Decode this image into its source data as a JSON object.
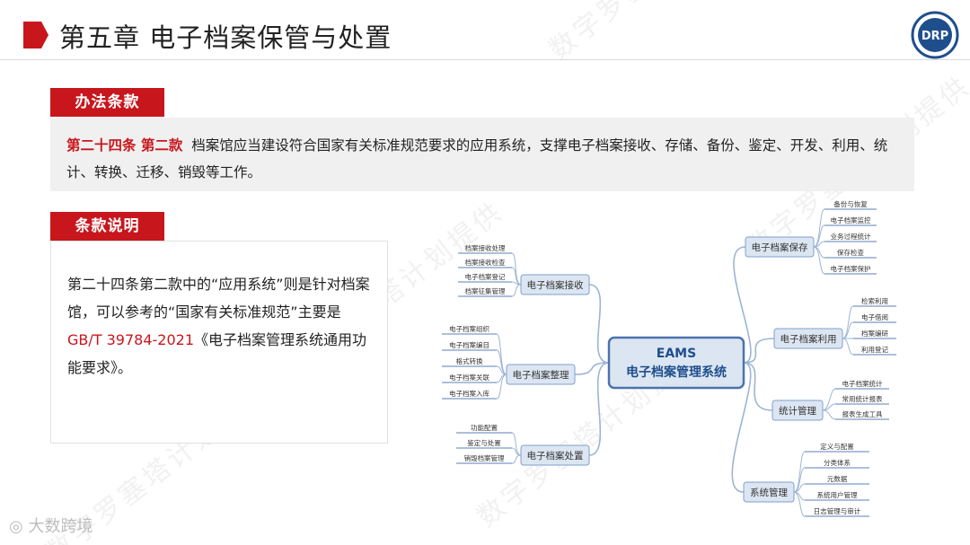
{
  "header": {
    "title": "第五章 电子档案保管与处置",
    "logo_text": "DRP"
  },
  "watermark": "数字罗塞塔计划提供",
  "section_measures": {
    "tag": "办法条款",
    "clause_ref": "第二十四条 第二款",
    "clause_text": "档案馆应当建设符合国家有关标准规范要求的应用系统，支撑电子档案接收、存储、备份、鉴定、开发、利用、统计、转换、迁移、销毁等工作。"
  },
  "section_explain": {
    "tag": "条款说明",
    "text_before": "第二十四条第二款中的“应用系统”则是针对档案馆，可以参考的“国家有关标准规范”主要是",
    "std_code": "GB/T 39784-2021",
    "text_after": "《电子档案管理系统通用功能要求》。"
  },
  "mindmap": {
    "center_line1": "EAMS",
    "center_line2": "电子档案管理系统",
    "branches": [
      {
        "label": "电子档案接收",
        "leaves": [
          "档案接收处理",
          "档案接收检查",
          "电子档案登记",
          "档案征集管理"
        ]
      },
      {
        "label": "电子档案整理",
        "leaves": [
          "电子档案组织",
          "电子档案编目",
          "格式转换",
          "电子档案关联",
          "电子档案入库"
        ]
      },
      {
        "label": "电子档案处置",
        "leaves": [
          "功能配置",
          "鉴定与处置",
          "销毁档案管理"
        ]
      },
      {
        "label": "电子档案保存",
        "leaves": [
          "备份与恢复",
          "电子档案监控",
          "业务过程统计",
          "保存检查",
          "电子档案保护"
        ]
      },
      {
        "label": "电子档案利用",
        "leaves": [
          "检索利用",
          "电子借阅",
          "档案编研",
          "利用登记"
        ]
      },
      {
        "label": "统计管理",
        "leaves": [
          "电子档案统计",
          "常用统计报表",
          "报表生成工具"
        ]
      },
      {
        "label": "系统管理",
        "leaves": [
          "定义与配置",
          "分类体系",
          "元数据",
          "系统用户管理",
          "日志管理与审计"
        ]
      }
    ]
  },
  "footer": {
    "brand": "大数跨境"
  },
  "colors": {
    "accent_red": "#c8161d",
    "node_blue": "#1f4e8c",
    "node_fill": "#dce6f2"
  }
}
